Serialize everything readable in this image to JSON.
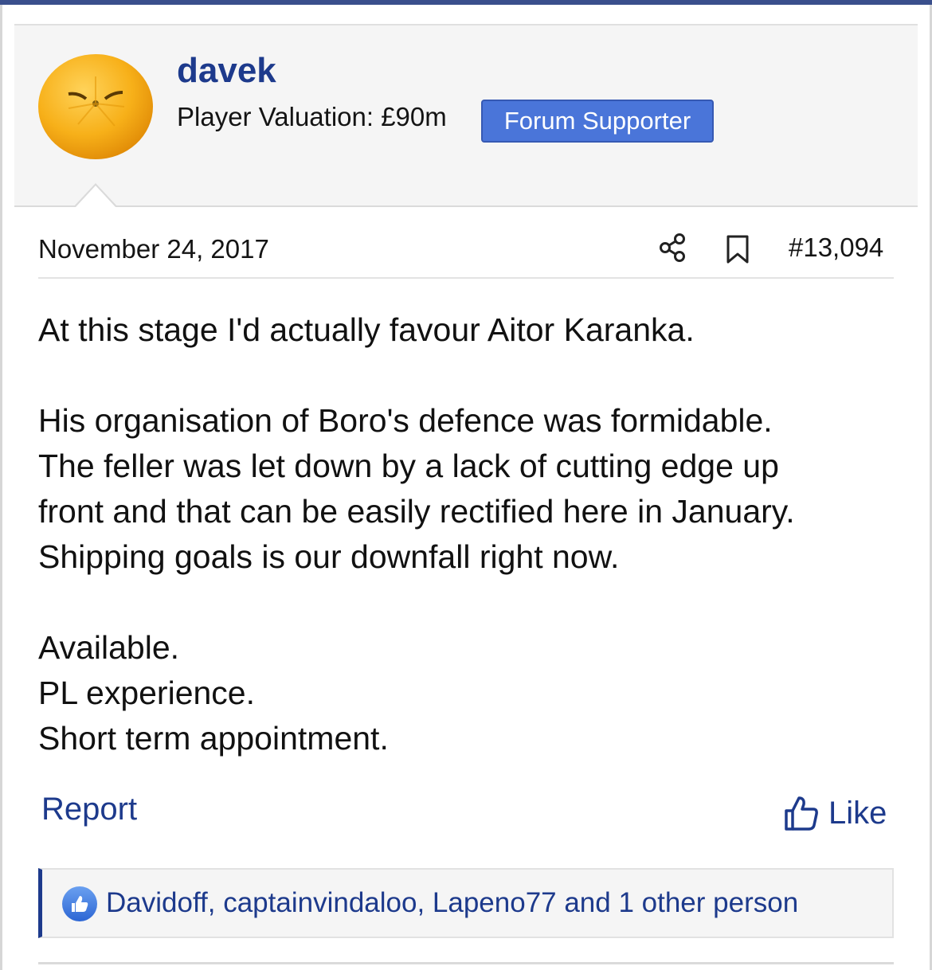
{
  "user": {
    "name": "davek",
    "valuation": "Player Valuation: £90m",
    "badge": "Forum Supporter",
    "avatar_icon": "orange-fruit-face-avatar"
  },
  "post": {
    "date": "November 24, 2017",
    "number": "#13,094",
    "share_icon": "share-icon",
    "bookmark_icon": "bookmark-icon",
    "body": {
      "p1": {
        "l1": "At this stage I'd actually favour Aitor Karanka."
      },
      "p2": {
        "l1": "His organisation of Boro's defence was formidable.",
        "l2": "The feller was let down by a lack of cutting edge up",
        "l3": "front and that can be easily rectified here in January.",
        "l4": "Shipping goals is our downfall right now."
      },
      "p3": {
        "l1": "Available.",
        "l2": "PL experience.",
        "l3": "Short term appointment."
      }
    }
  },
  "actions": {
    "report": "Report",
    "like": "Like"
  },
  "reactions": {
    "text": "Davidoff, captainvindaloo, Lapeno77 and 1 other person"
  },
  "colors": {
    "link": "#1d3a8c",
    "badge_bg": "#4a75d9",
    "header_bg": "#f5f5f5",
    "avatar_orange": "#f7b019"
  }
}
